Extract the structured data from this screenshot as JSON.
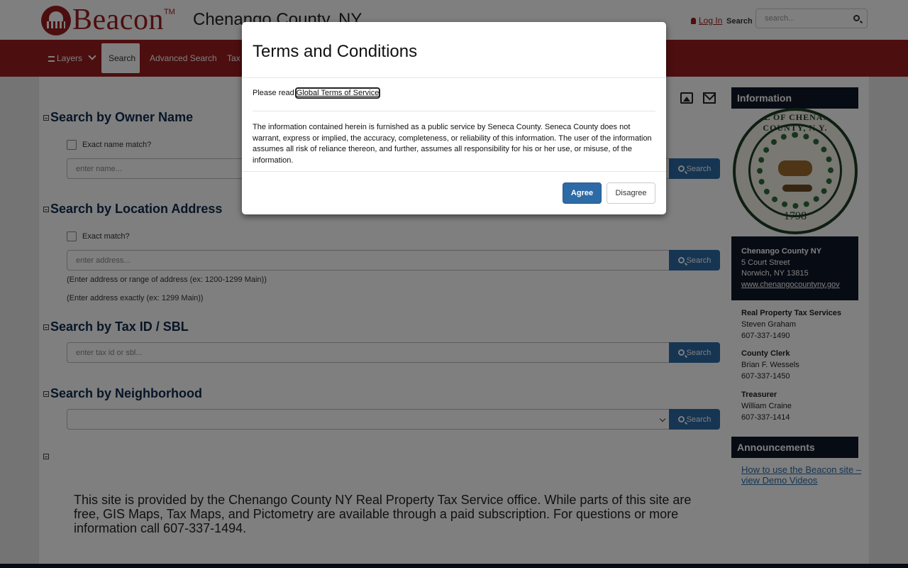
{
  "header": {
    "logo_text": "Beacon",
    "logo_tm": "TM",
    "county": "Chenango County, NY",
    "login_label": "Log In",
    "search_label": "Search",
    "search_placeholder": "search..."
  },
  "nav": {
    "items": [
      {
        "label": "Layers"
      },
      {
        "label": "Search"
      },
      {
        "label": "Advanced Search"
      },
      {
        "label": "Tax"
      }
    ],
    "active": "Search"
  },
  "sections": {
    "owner": {
      "title": "Search by Owner Name",
      "checkbox_label": "Exact name match?",
      "placeholder": "enter name...",
      "button": "Search"
    },
    "address": {
      "title": "Search by Location Address",
      "checkbox_label": "Exact match?",
      "placeholder": "enter address...",
      "button": "Search",
      "hint1": "(Enter address or range of address (ex: 1200-1299 Main))",
      "hint2": "(Enter address exactly (ex: 1299 Main))"
    },
    "taxid": {
      "title": "Search by Tax ID / SBL",
      "placeholder": "enter tax id or sbl...",
      "button": "Search"
    },
    "neighborhood": {
      "title": "Search by Neighborhood",
      "selected": "",
      "button": "Search"
    }
  },
  "notice": "This site is provided by the Chenango County NY Real Property Tax Service office. While parts of this site are free, GIS Maps, Tax Maps, and Pictometry are available through a paid subscription. For questions or more information call 607-337-1494.",
  "sidebar": {
    "info_title": "Information",
    "seal": {
      "top_text": "SEAL OF CHENANGO COUNTY, N.Y.",
      "year": "1798"
    },
    "address": {
      "name": "Chenango County NY",
      "street": "5 Court Street",
      "city": "Norwich, NY 13815",
      "website": "www.chenangocountyny.gov"
    },
    "contacts": [
      {
        "title": "Real Property Tax Services",
        "name": "Steven Graham",
        "phone": "607-337-1490"
      },
      {
        "title": "County Clerk",
        "name": "Brian F. Wessels",
        "phone": "607-337-1450"
      },
      {
        "title": "Treasurer",
        "name": "William Craine",
        "phone": "607-337-1414"
      }
    ],
    "announcements_title": "Announcements",
    "announcement_link": "How to use the Beacon site – view Demo Videos"
  },
  "modal": {
    "title": "Terms and Conditions",
    "read_prefix": "Please read ",
    "read_link": "Global Terms of Service",
    "body": "The information contained herein is furnished as a public service by Seneca County. Seneca County does not warrant, express or implied, the accuracy, completeness, or reliability of this information. The user of the information assumes all risk of reliance thereon, and further, assumes all responsibility for his or her use, or misuse, of the information.",
    "agree": "Agree",
    "disagree": "Disagree"
  },
  "colors": {
    "brand_red": "#9b1c1f",
    "navy": "#0e1729",
    "button_blue": "#2d6aa6"
  }
}
